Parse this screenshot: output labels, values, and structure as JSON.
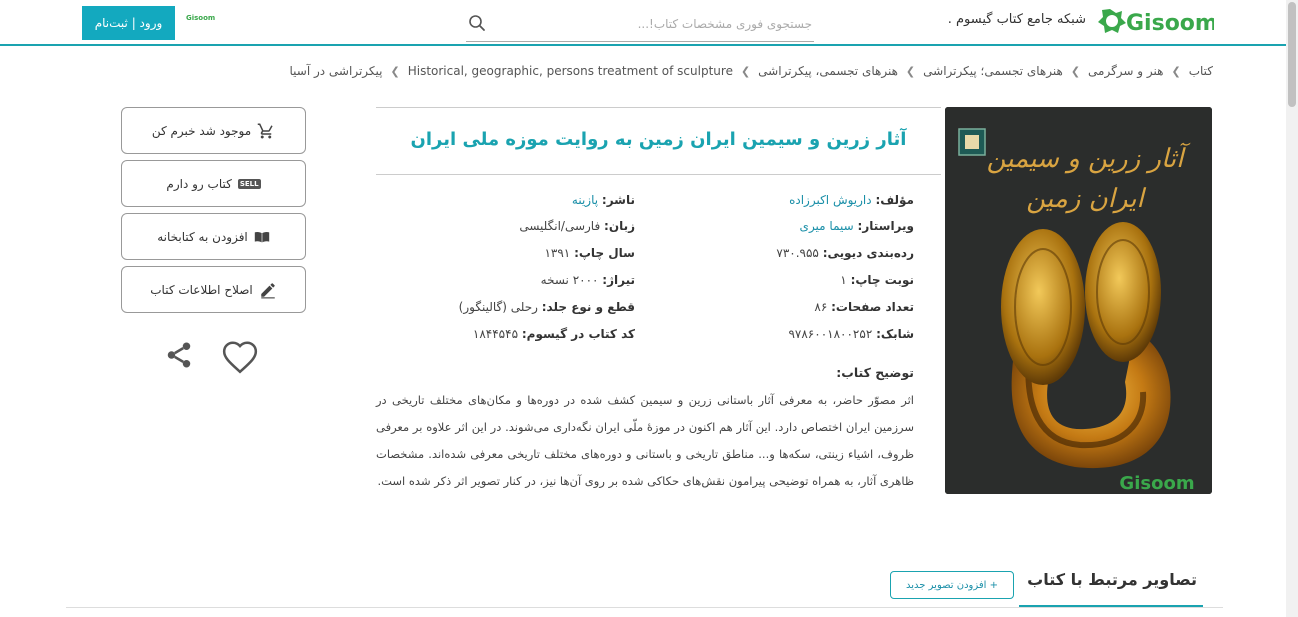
{
  "header": {
    "logo_text": "Gisoom",
    "tagline": "شبکه جامع کتاب گیسوم .",
    "search_placeholder": "جستجوی فوری مشخصات کتاب!...",
    "mini_logo": "Gisoom",
    "login_label": "ورود | ثبت‌نام"
  },
  "breadcrumb": [
    "کتاب",
    "هنر و سرگرمی",
    "هنرهای تجسمی؛ پیکرتراشی",
    "هنرهای تجسمی، پیکرتراشی",
    "Historical, geographic, persons treatment of sculpture",
    "پیکرتراشی در آسیا"
  ],
  "book": {
    "title": "آثار زرین و سیمین ایران زمین به روایت موزه ملی ایران",
    "cover_title_line1": "آثار زرین و سیمین",
    "cover_title_line2": "ایران زمین",
    "cover_watermark": "Gisoom",
    "fields_right": [
      {
        "label": "مؤلف:",
        "value": "داریوش اکبرزاده",
        "link": true
      },
      {
        "label": "ویراستار:",
        "value": "سیما میری",
        "link": true
      },
      {
        "label": "رده‌بندی دیویی:",
        "value": "۷۳۰.۹۵۵",
        "link": false
      },
      {
        "label": "نوبت چاپ:",
        "value": "۱",
        "link": false
      },
      {
        "label": "تعداد صفحات:",
        "value": "۸۶",
        "link": false
      },
      {
        "label": "شابک:",
        "value": "۹۷۸۶۰۰۱۸۰۰۲۵۲",
        "link": false
      }
    ],
    "fields_left": [
      {
        "label": "ناشر:",
        "value": "پازینه",
        "link": true
      },
      {
        "label": "زبان:",
        "value": "فارسی/انگلیسی",
        "link": false
      },
      {
        "label": "سال چاپ:",
        "value": "۱۳۹۱",
        "link": false
      },
      {
        "label": "تیراژ:",
        "value": "۲۰۰۰ نسخه",
        "link": false
      },
      {
        "label": "قطع و نوع جلد:",
        "value": "رحلی (گالینگور)",
        "link": false
      },
      {
        "label": "کد کتاب در گیسوم:",
        "value": "۱۸۴۴۵۴۵",
        "link": false
      }
    ],
    "description_title": "توضیح کتاب:",
    "description": "اثر مصوّر حاضر، به معرفی آثار باستانی زرین و سیمین کشف شده در دوره‌ها و مکان‌های مختلف تاریخی در سرزمین ایران اختصاص دارد. این آثار هم اکنون در موزهٔ ملّی ایران نگه‌داری می‌شوند. در این اثر علاوه بر معرفی ظروف، اشیاء زینتی، سکه‌ها و... مناطق تاریخی و باستانی و دوره‌های مختلف تاریخی معرفی شده‌اند. مشخصات ظاهری آثار، به همراه توضیحی پیرامون نقش‌های حکاکی شده بر روی آن‌ها نیز، در کنار تصویر اثر ذکر شده است."
  },
  "actions": {
    "notify": "موجود شد خبرم کن",
    "sell_badge": "SELL",
    "sell": "کتاب رو دارم",
    "library": "افزودن به کتابخانه",
    "edit": "اصلاح اطلاعات کتاب"
  },
  "related": {
    "tab_label": "تصاویر مرتبط با کتاب",
    "add_button": "+ افزودن تصویر جدید"
  },
  "colors": {
    "accent": "#1aa3b0",
    "brand_green": "#3aa84b",
    "link": "#1a8fa8"
  }
}
